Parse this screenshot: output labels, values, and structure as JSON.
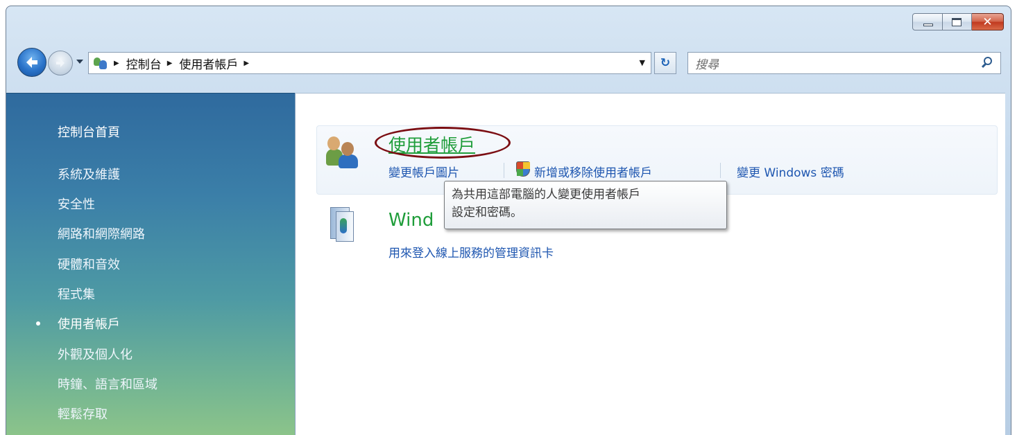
{
  "window": {
    "caption_buttons": {
      "minimize": "minimize",
      "maximize": "maximize",
      "close": "✕"
    }
  },
  "nav": {
    "breadcrumbs": [
      "控制台",
      "使用者帳戶"
    ],
    "search_placeholder": "搜尋"
  },
  "sidebar": {
    "home": "控制台首頁",
    "items": [
      "系統及維護",
      "安全性",
      "網路和網際網路",
      "硬體和音效",
      "程式集",
      "使用者帳戶",
      "外觀及個人化",
      "時鐘、語言和區域",
      "輕鬆存取"
    ],
    "current_index": 5
  },
  "main": {
    "category": {
      "title": "使用者帳戶",
      "tasks": [
        "變更帳戶圖片",
        "新增或移除使用者帳戶",
        "變更 Windows 密碼"
      ]
    },
    "tooltip": {
      "line1": "為共用這部電腦的人變更使用者帳戶",
      "line2": "設定和密碼。"
    },
    "category2": {
      "title_visible": "Wind",
      "task": "用來登入線上服務的管理資訊卡"
    }
  }
}
